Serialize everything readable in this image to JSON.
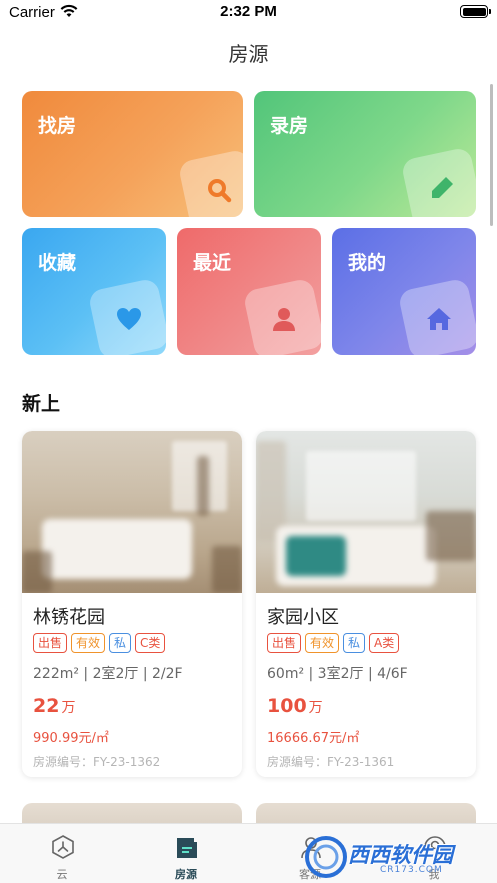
{
  "status_bar": {
    "carrier": "Carrier",
    "time": "2:32 PM"
  },
  "nav": {
    "title": "房源"
  },
  "tiles": [
    {
      "label": "找房",
      "icon": "search-icon"
    },
    {
      "label": "录房",
      "icon": "pencil-icon"
    },
    {
      "label": "收藏",
      "icon": "heart-icon"
    },
    {
      "label": "最近",
      "icon": "person-icon"
    },
    {
      "label": "我的",
      "icon": "home-icon"
    }
  ],
  "section": {
    "title": "新上"
  },
  "listings": [
    {
      "name": "林锈花园",
      "tags": [
        "出售",
        "有效",
        "私",
        "C类"
      ],
      "spec": "222m² | 2室2厅 | 2/2F",
      "price": "22",
      "price_unit": "万",
      "unit_price": "990.99元/㎡",
      "code": "房源编号：FY-23-1362"
    },
    {
      "name": "家园小区",
      "tags": [
        "出售",
        "有效",
        "私",
        "A类"
      ],
      "spec": "60m² | 3室2厅 | 4/6F",
      "price": "100",
      "price_unit": "万",
      "unit_price": "16666.67元/㎡",
      "code": "房源编号：FY-23-1361"
    }
  ],
  "tab_bar": {
    "active": "房源",
    "tabs": [
      {
        "label": "云",
        "icon": "hexagon-icon"
      },
      {
        "label": "房源",
        "icon": "house-doc-icon"
      },
      {
        "label": "客源",
        "icon": "customer-icon"
      },
      {
        "label": "我",
        "icon": "profile-icon"
      }
    ]
  },
  "watermark": {
    "text": "西西软件园",
    "sub": "CR173.COM"
  },
  "colors": {
    "price": "#e8523f",
    "tab_active": "#2a4b58",
    "tile_find": "#f08a3c",
    "tile_record": "#52c57a",
    "tile_fav": "#3aa7f0",
    "tile_recent": "#ef6a6a",
    "tile_mine": "#5b6fe6"
  }
}
